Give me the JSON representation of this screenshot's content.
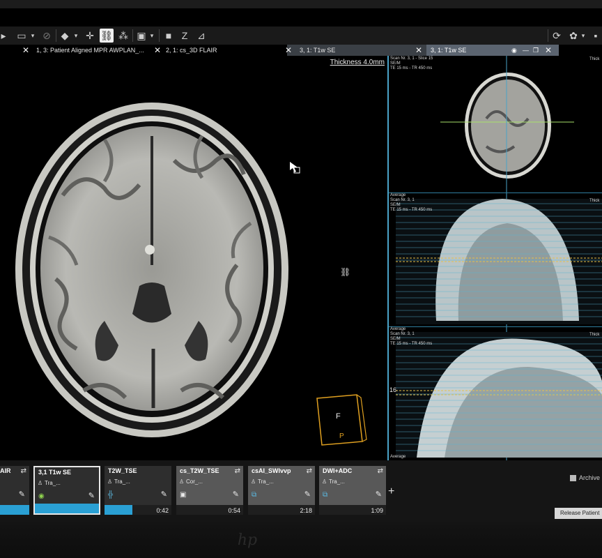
{
  "tabs": [
    {
      "label": "1, 3: Patient Aligned MPR AWPLAN_..."
    },
    {
      "label": "2, 1: cs_3D FLAIR"
    },
    {
      "label": "3, 1: T1w SE"
    },
    {
      "label": "3, 1: T1w SE"
    }
  ],
  "main_view": {
    "thickness": "Thickness 4.0mm",
    "cube_front": "F",
    "cube_bottom": "P"
  },
  "right_panel": {
    "axial_info": {
      "line1": "Scan Nr. 3, 1 - Slice 15",
      "line2": "SE/M",
      "line3": "TE 15 ms - TR 450 ms"
    },
    "top_right_label": "Thick",
    "coronal_info": {
      "line0": "Average",
      "line1": "Scan Nr. 3, 1",
      "line2": "SE/M",
      "line3": "TE 15 ms - TR 450 ms",
      "right": "Thick"
    },
    "sagittal_info": {
      "line0": "Average",
      "line1": "Scan Nr. 3, 1",
      "line2": "SE/M",
      "line3": "TE 15 ms - TR 450 ms",
      "right": "Thick"
    },
    "slice_marker": "16",
    "bottom_label": "Average"
  },
  "series_cards": [
    {
      "title": "AIR",
      "sub": "",
      "duration": ""
    },
    {
      "title": "3,1 T1w SE",
      "sub": "Tra_...",
      "duration": ""
    },
    {
      "title": "T2W_TSE",
      "sub": "Tra_...",
      "duration": "0:42"
    },
    {
      "title": "cs_T2W_TSE",
      "sub": "Cor_...",
      "duration": "0:54"
    },
    {
      "title": "csAI_SWIvvp",
      "sub": "Tra_...",
      "duration": "2:18"
    },
    {
      "title": "DWI+ADC",
      "sub": "Tra_...",
      "duration": "1:09"
    }
  ],
  "actions": {
    "add": "+",
    "archive": "Archive",
    "release": "Release Patient"
  },
  "brand": "hp",
  "colors": {
    "accent": "#2aa0d4",
    "cube": "#e0a020",
    "crosshair_h": "#a8e06a",
    "crosshair_v": "#4aa3c8"
  }
}
